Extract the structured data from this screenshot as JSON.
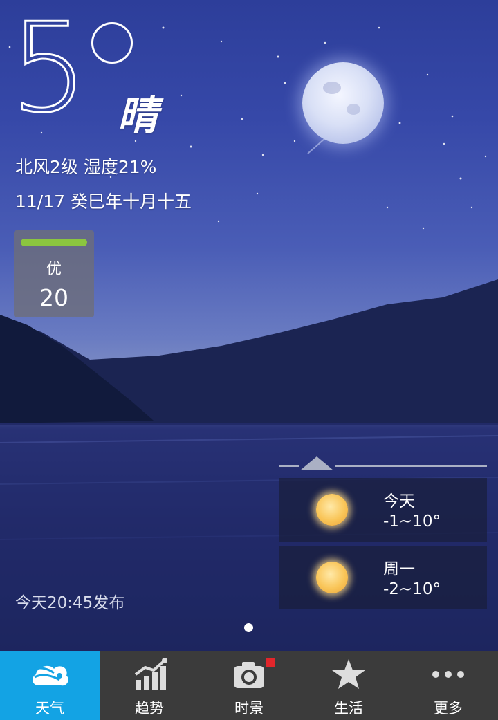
{
  "weather": {
    "temperature": "5",
    "condition": "晴",
    "wind_humidity": "北风2级 湿度21%",
    "date": "11/17 癸巳年十月十五",
    "published": "今天20:45发布"
  },
  "aqi": {
    "level": "优",
    "value": "20",
    "bar_color": "#8bc53f"
  },
  "forecast": [
    {
      "day": "今天",
      "range": "-1~10°",
      "icon": "sun-icon"
    },
    {
      "day": "周一",
      "range": "-2~10°",
      "icon": "sun-icon"
    }
  ],
  "tabs": [
    {
      "label": "天气",
      "icon": "weather-cloud-icon",
      "active": true
    },
    {
      "label": "趋势",
      "icon": "trend-chart-icon",
      "active": false
    },
    {
      "label": "时景",
      "icon": "camera-icon",
      "active": false
    },
    {
      "label": "生活",
      "icon": "star-icon",
      "active": false
    },
    {
      "label": "更多",
      "icon": "more-dots-icon",
      "active": false
    }
  ],
  "colors": {
    "active_tab": "#13a3e4",
    "tabbar": "#3b3b3b",
    "notification": "#e2262b"
  }
}
